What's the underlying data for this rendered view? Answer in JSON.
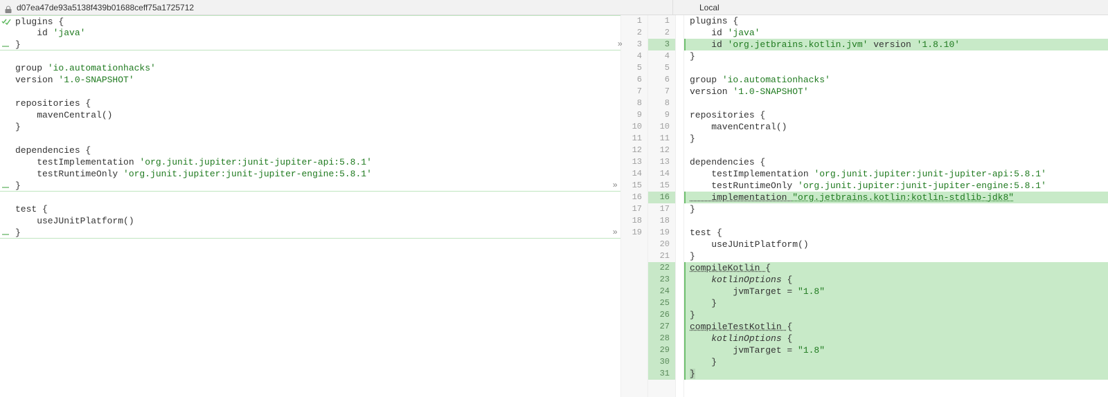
{
  "header": {
    "left_title": "d07ea47de93a5138f439b01688ceff75a1725712",
    "right_title": "Local"
  },
  "left": {
    "lines": [
      {
        "t": "plugins {",
        "cls": "sep-top"
      },
      {
        "t": "    id ",
        "s": "'java'"
      },
      {
        "t": "}",
        "cls": "sep-bot"
      },
      {
        "t": ""
      },
      {
        "t": "group ",
        "s": "'io.automationhacks'"
      },
      {
        "t": "version ",
        "s": "'1.0-SNAPSHOT'"
      },
      {
        "t": ""
      },
      {
        "t": "repositories {"
      },
      {
        "t": "    mavenCentral()"
      },
      {
        "t": "}"
      },
      {
        "t": ""
      },
      {
        "t": "dependencies {"
      },
      {
        "t": "    testImplementation ",
        "s": "'org.junit.jupiter:junit-jupiter-api:5.8.1'"
      },
      {
        "t": "    testRuntimeOnly ",
        "s": "'org.junit.jupiter:junit-jupiter-engine:5.8.1'"
      },
      {
        "t": "}",
        "cls": "sep-bot"
      },
      {
        "t": ""
      },
      {
        "t": "test {"
      },
      {
        "t": "    useJUnitPlatform()"
      },
      {
        "t": "}",
        "cls": "sep-bot"
      }
    ]
  },
  "gutter": {
    "left_numbers": [
      {
        "n": "1"
      },
      {
        "n": "2"
      },
      {
        "n": "3",
        "marker": true
      },
      {
        "n": "4"
      },
      {
        "n": "5"
      },
      {
        "n": "6"
      },
      {
        "n": "7"
      },
      {
        "n": "8"
      },
      {
        "n": "9"
      },
      {
        "n": "10"
      },
      {
        "n": "11"
      },
      {
        "n": "12"
      },
      {
        "n": "13"
      },
      {
        "n": "14"
      },
      {
        "n": "15",
        "marker": true
      },
      {
        "n": "16"
      },
      {
        "n": "17"
      },
      {
        "n": "18"
      },
      {
        "n": "19",
        "marker": true
      }
    ],
    "right_numbers": [
      {
        "n": "1"
      },
      {
        "n": "2"
      },
      {
        "n": "3",
        "ins": true
      },
      {
        "n": "4"
      },
      {
        "n": "5"
      },
      {
        "n": "6"
      },
      {
        "n": "7"
      },
      {
        "n": "8"
      },
      {
        "n": "9"
      },
      {
        "n": "10"
      },
      {
        "n": "11"
      },
      {
        "n": "12"
      },
      {
        "n": "13"
      },
      {
        "n": "14"
      },
      {
        "n": "15"
      },
      {
        "n": "16",
        "ins": true
      },
      {
        "n": "17"
      },
      {
        "n": "18"
      },
      {
        "n": "19"
      },
      {
        "n": "20"
      },
      {
        "n": "21"
      },
      {
        "n": "22",
        "ins": true
      },
      {
        "n": "23",
        "ins": true
      },
      {
        "n": "24",
        "ins": true
      },
      {
        "n": "25",
        "ins": true
      },
      {
        "n": "26",
        "ins": true
      },
      {
        "n": "27",
        "ins": true
      },
      {
        "n": "28",
        "ins": true
      },
      {
        "n": "29",
        "ins": true
      },
      {
        "n": "30",
        "ins": true
      },
      {
        "n": "31",
        "ins": true
      }
    ]
  },
  "right": {
    "lines": [
      {
        "t": "plugins {"
      },
      {
        "t": "    id ",
        "s": "'java'"
      },
      {
        "t": "    id ",
        "s": "'org.jetbrains.kotlin.jvm'",
        "post": " version ",
        "s2": "'1.8.10'",
        "ins": true
      },
      {
        "t": "}"
      },
      {
        "t": ""
      },
      {
        "t": "group ",
        "s": "'io.automationhacks'"
      },
      {
        "t": "version ",
        "s": "'1.0-SNAPSHOT'"
      },
      {
        "t": ""
      },
      {
        "t": "repositories {"
      },
      {
        "t": "    mavenCentral()"
      },
      {
        "t": "}"
      },
      {
        "t": ""
      },
      {
        "t": "dependencies {"
      },
      {
        "t": "    testImplementation ",
        "s": "'org.junit.jupiter:junit-jupiter-api:5.8.1'"
      },
      {
        "t": "    testRuntimeOnly ",
        "s": "'org.junit.jupiter:junit-jupiter-engine:5.8.1'"
      },
      {
        "t": "    implementation ",
        "s": "\"org.jetbrains.kotlin:kotlin-stdlib-jdk8\"",
        "ins": true,
        "u": true
      },
      {
        "t": "}"
      },
      {
        "t": ""
      },
      {
        "t": "test {"
      },
      {
        "t": "    useJUnitPlatform()"
      },
      {
        "t": "}"
      },
      {
        "t": "compileKotlin ",
        "brace": "{",
        "ins": true,
        "u": true
      },
      {
        "t": "    kotlinOptions ",
        "brace": "{",
        "ins": true,
        "fn": true
      },
      {
        "t": "        jvmTarget = ",
        "s": "\"1.8\"",
        "ins": true
      },
      {
        "t": "    }",
        "ins": true
      },
      {
        "t": "}",
        "ins": true
      },
      {
        "t": "compileTestKotlin ",
        "brace": "{",
        "ins": true,
        "u": true
      },
      {
        "t": "    kotlinOptions ",
        "brace": "{",
        "ins": true,
        "fn": true
      },
      {
        "t": "        jvmTarget = ",
        "s": "\"1.8\"",
        "ins": true
      },
      {
        "t": "    }",
        "ins": true
      },
      {
        "t": "",
        "brace": "}",
        "ins": true,
        "bracehl": true
      }
    ]
  }
}
